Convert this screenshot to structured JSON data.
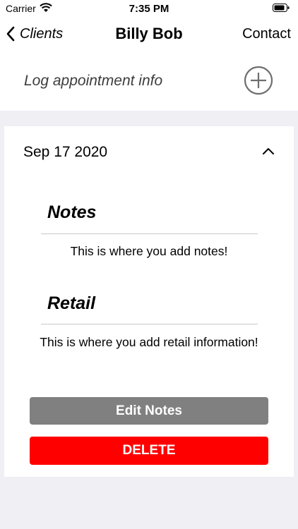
{
  "status_bar": {
    "carrier": "Carrier",
    "time": "7:35 PM"
  },
  "nav": {
    "back_label": "Clients",
    "title": "Billy Bob",
    "contact_label": "Contact"
  },
  "log_row": {
    "label": "Log appointment info",
    "add_icon": "plus-circle-icon"
  },
  "appointment": {
    "date": "Sep 17 2020",
    "collapse_icon": "chevron-up-icon",
    "notes_heading": "Notes",
    "notes_text": "This is where you add notes!",
    "retail_heading": "Retail",
    "retail_text": "This is where you add retail information!",
    "edit_label": "Edit Notes",
    "delete_label": "DELETE"
  },
  "colors": {
    "background": "#efeff4",
    "edit_button": "#808080",
    "delete_button": "#ff0000"
  }
}
